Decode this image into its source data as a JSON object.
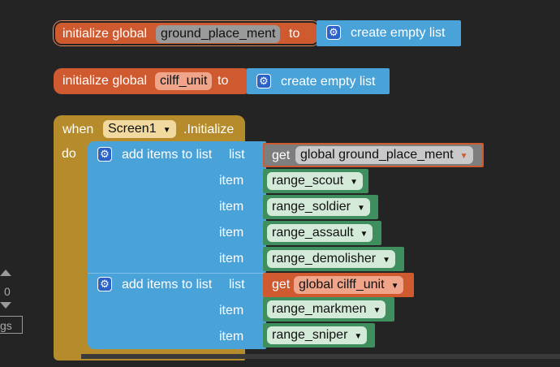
{
  "global1": {
    "initialize_label": "initialize global",
    "var_name": "ground_place_ment",
    "to_label": "to",
    "value_label": "create empty list"
  },
  "global2": {
    "initialize_label": "initialize global",
    "var_name": "cilff_unit",
    "to_label": "to",
    "value_label": "create empty list"
  },
  "event": {
    "when_label": "when",
    "component": "Screen1",
    "event_name": ".Initialize",
    "do_label": "do"
  },
  "add1": {
    "label": "add items to list",
    "list_label": "list",
    "get_label": "get",
    "get_var": "global ground_place_ment",
    "item_label": "item",
    "items": [
      "range_scout",
      "range_soldier",
      "range_assault",
      "range_demolisher"
    ]
  },
  "add2": {
    "label": "add items to list",
    "list_label": "list",
    "get_label": "get",
    "get_var": "global cilff_unit",
    "item_label": "item",
    "items": [
      "range_markmen",
      "range_sniper"
    ]
  },
  "workspace": {
    "zoom_value": "0",
    "tag_label": "gs"
  },
  "colors": {
    "background": "#242424",
    "variable_block": "#d05a30",
    "list_block": "#4aa3d8",
    "event_block": "#b58b2c",
    "text_block": "#3f8f5e"
  }
}
